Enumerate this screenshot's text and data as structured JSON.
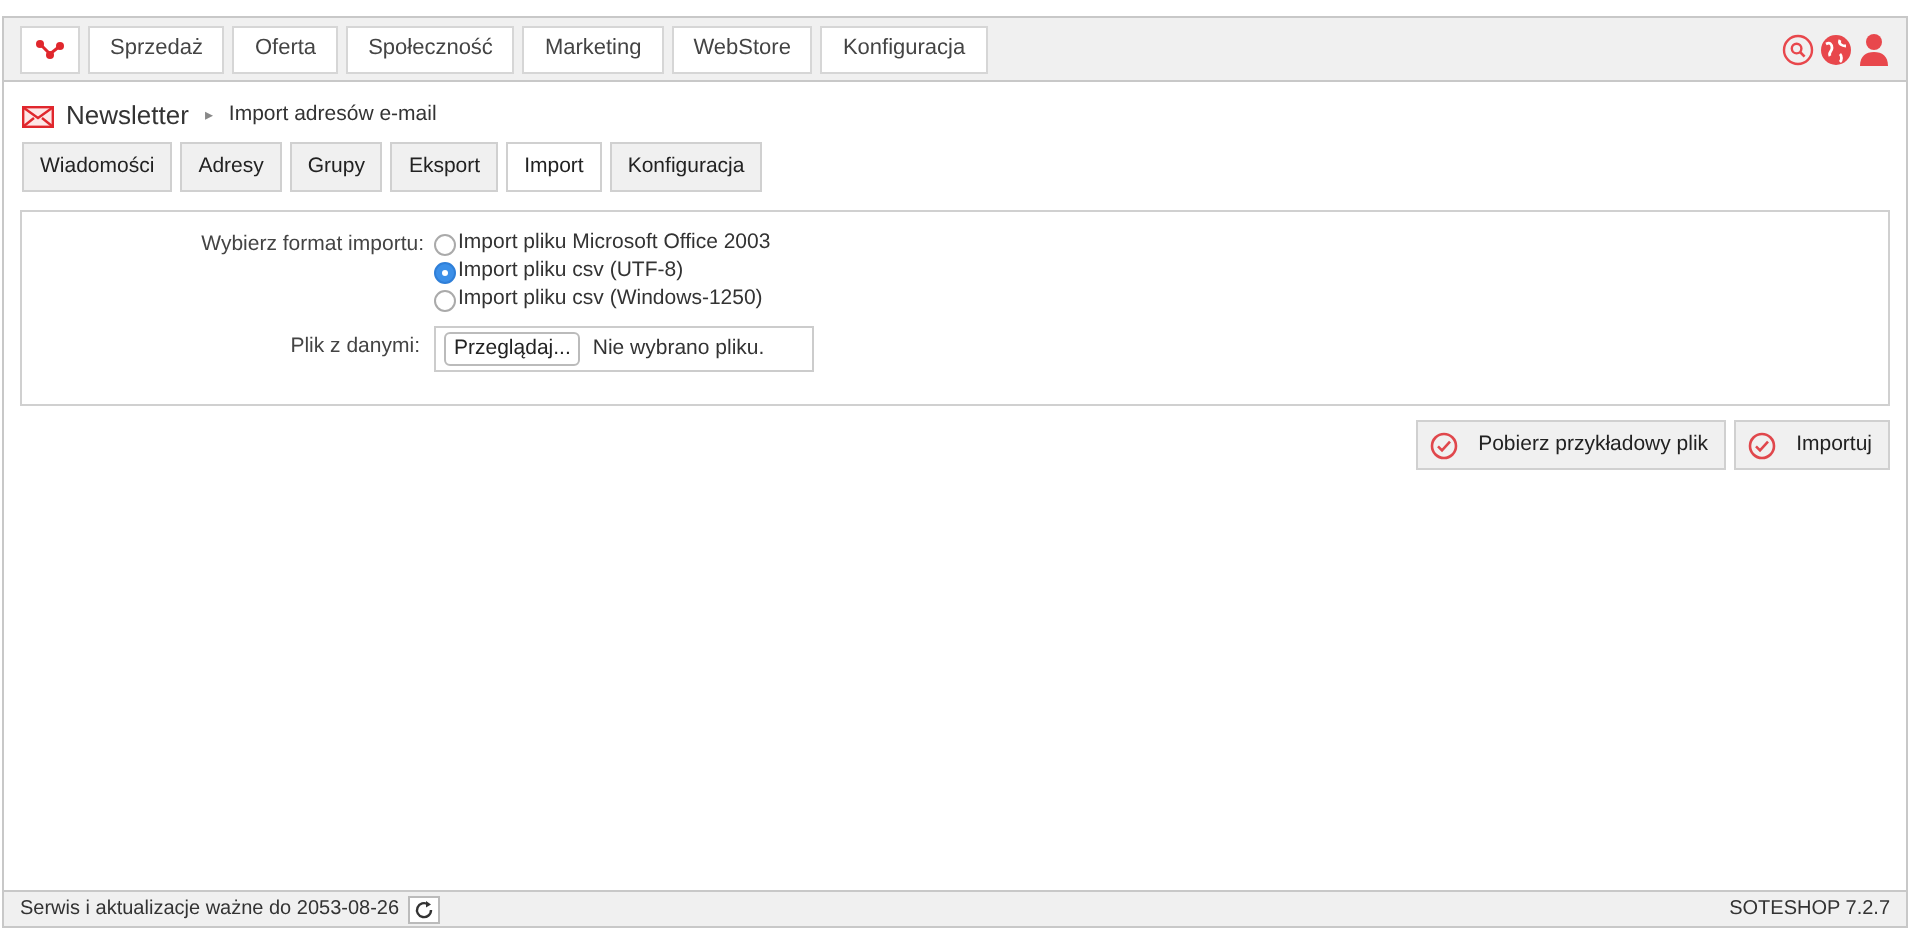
{
  "top_menu": [
    {
      "label": "Sprzedaż"
    },
    {
      "label": "Oferta"
    },
    {
      "label": "Społeczność"
    },
    {
      "label": "Marketing"
    },
    {
      "label": "WebStore"
    },
    {
      "label": "Konfiguracja"
    }
  ],
  "breadcrumb": {
    "module": "Newsletter",
    "separator": "▸",
    "page": "Import adresów e-mail"
  },
  "tabs": [
    {
      "label": "Wiadomości",
      "selected": false
    },
    {
      "label": "Adresy",
      "selected": false
    },
    {
      "label": "Grupy",
      "selected": false
    },
    {
      "label": "Eksport",
      "selected": false
    },
    {
      "label": "Import",
      "selected": true
    },
    {
      "label": "Konfiguracja",
      "selected": false
    }
  ],
  "form": {
    "format_label": "Wybierz format importu:",
    "formats": [
      {
        "label": "Import pliku Microsoft Office 2003",
        "selected": false
      },
      {
        "label": "Import pliku csv (UTF-8)",
        "selected": true
      },
      {
        "label": "Import pliku csv (Windows-1250)",
        "selected": false
      }
    ],
    "file_label": "Plik z danymi:",
    "browse_button": "Przeglądaj...",
    "file_status": "Nie wybrano pliku."
  },
  "actions": [
    "Pobierz przykładowy plik",
    "Importuj"
  ],
  "status_bar": {
    "license": "Serwis i aktualizacje ważne do 2053-08-26",
    "version": "SOTESHOP 7.2.7"
  }
}
